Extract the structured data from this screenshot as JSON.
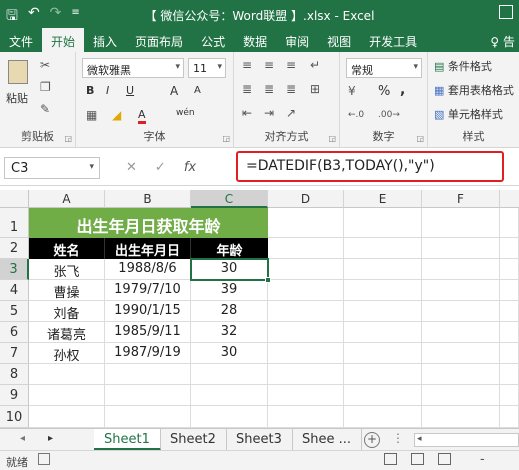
{
  "window": {
    "title": "【 微信公众号：Word联盟 】.xlsx - Excel"
  },
  "quick_access": {
    "save_icon": "save-icon",
    "undo_icon": "undo-icon",
    "redo_icon": "redo-icon"
  },
  "tabs": [
    {
      "label": "文件"
    },
    {
      "label": "开始"
    },
    {
      "label": "插入"
    },
    {
      "label": "页面布局"
    },
    {
      "label": "公式"
    },
    {
      "label": "数据"
    },
    {
      "label": "审阅"
    },
    {
      "label": "视图"
    },
    {
      "label": "开发工具"
    }
  ],
  "tell_me": "♀ 告",
  "ribbon": {
    "clipboard": {
      "paste": "粘贴",
      "label": "剪贴板"
    },
    "font": {
      "name": "微软雅黑",
      "size": "11",
      "bold": "B",
      "italic": "I",
      "underline": "U",
      "grow": "A",
      "shrink": "A",
      "font_color": "A",
      "phonetic": "wén",
      "label": "字体"
    },
    "alignment": {
      "label": "对齐方式"
    },
    "number": {
      "format": "常规",
      "percent": "%",
      "comma": ",",
      "label": "数字"
    },
    "styles": {
      "conditional": "条件格式",
      "table": "套用表格格式",
      "cell": "单元格样式",
      "label": "样式"
    }
  },
  "formula_bar": {
    "name_box": "C3",
    "cancel": "✕",
    "enter": "✓",
    "fx": "fx",
    "formula": "=DATEDIF(B3,TODAY(),\"y\")"
  },
  "sheet": {
    "columns": [
      "A",
      "B",
      "C",
      "D",
      "E",
      "F"
    ],
    "rows": [
      "1",
      "2",
      "3",
      "4",
      "5",
      "6",
      "7",
      "8",
      "9",
      "10"
    ],
    "banner": "出生年月日获取年龄",
    "headers": [
      "姓名",
      "出生年月日",
      "年龄"
    ],
    "data": [
      {
        "name": "张飞",
        "birth": "1988/8/6",
        "age": "30"
      },
      {
        "name": "曹操",
        "birth": "1979/7/10",
        "age": "39"
      },
      {
        "name": "刘备",
        "birth": "1990/1/15",
        "age": "28"
      },
      {
        "name": "诸葛亮",
        "birth": "1985/9/11",
        "age": "32"
      },
      {
        "name": "孙权",
        "birth": "1987/9/19",
        "age": "30"
      }
    ]
  },
  "sheet_tabs": [
    {
      "label": "Sheet1"
    },
    {
      "label": "Sheet2"
    },
    {
      "label": "Sheet3"
    },
    {
      "label": "Shee ..."
    }
  ],
  "add_sheet": "+",
  "status": {
    "ready": "就绪",
    "zoom_minus": "-"
  },
  "colors": {
    "brand": "#217346",
    "banner": "#70ad47",
    "header_fill": "#000000",
    "highlight_border": "#e02020"
  }
}
